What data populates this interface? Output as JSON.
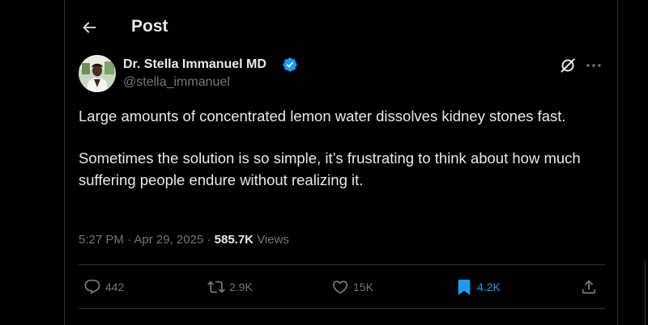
{
  "header": {
    "title": "Post"
  },
  "author": {
    "display_name": "Dr. Stella Immanuel MD",
    "handle": "@stella_immanuel"
  },
  "tweet": {
    "paragraphs": [
      "Large amounts of concentrated lemon water dissolves kidney stones fast.",
      "Sometimes the solution is so simple, it’s frustrating to think about how much suffering people endure without realizing it."
    ],
    "time": "5:27 PM",
    "date": "Apr 29, 2025",
    "views": "585.7K",
    "views_label": "Views"
  },
  "actions": {
    "replies": "442",
    "reposts": "2.9K",
    "likes": "15K",
    "bookmarks": "4.2K"
  },
  "colors": {
    "accent": "#1d9bf0",
    "muted": "#71767b",
    "text": "#e7e9ea",
    "border": "#2f3336"
  }
}
